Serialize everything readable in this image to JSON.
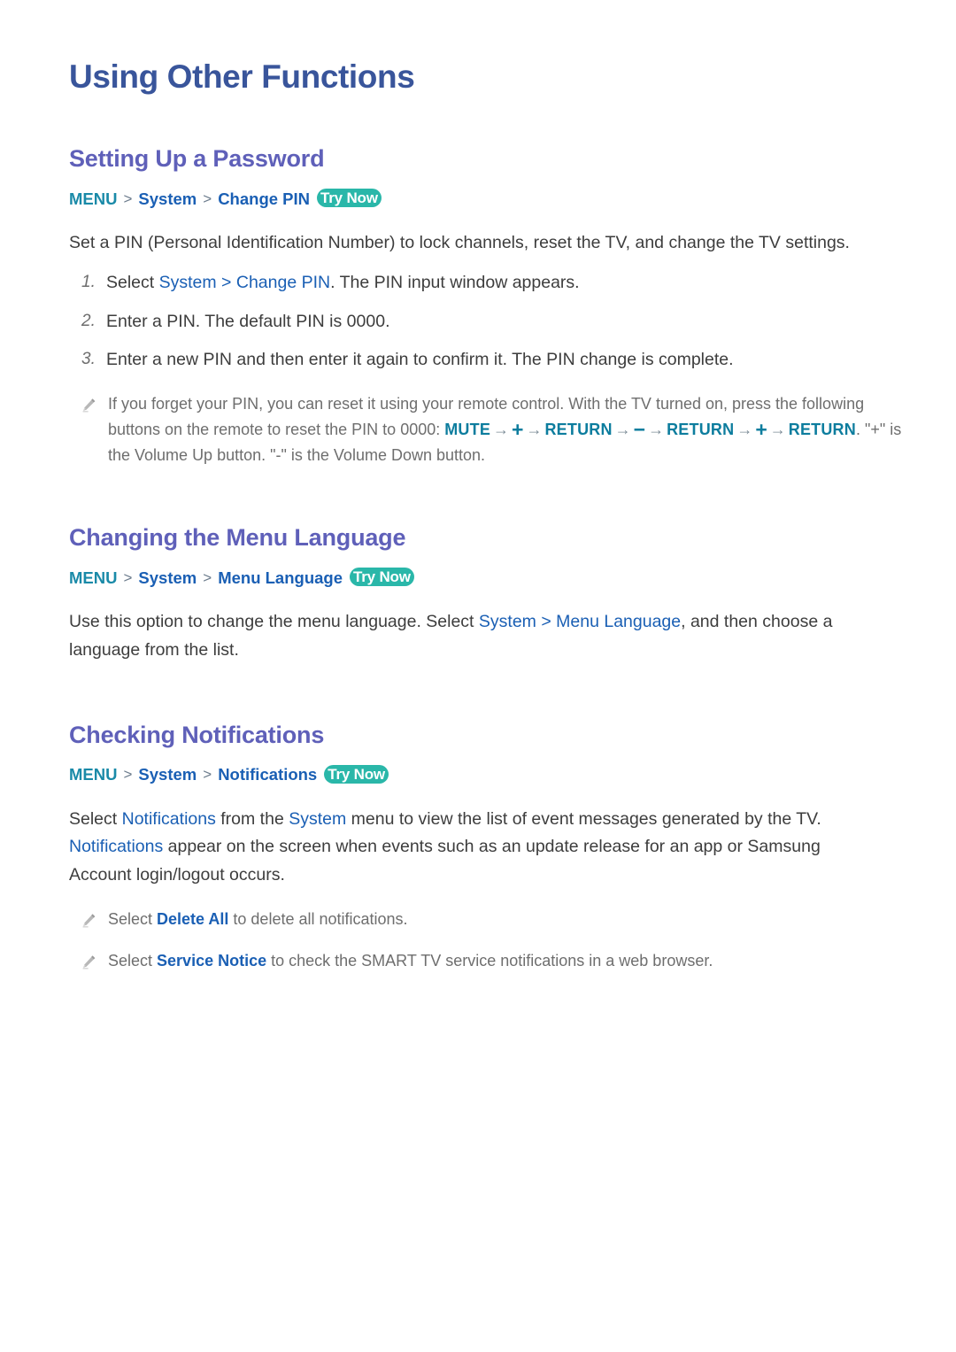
{
  "document": {
    "title": "Using Other Functions"
  },
  "sections": [
    {
      "heading": "Setting Up a Password",
      "path": {
        "menu": "MENU",
        "sep": ">",
        "item1": "System",
        "item2": "Change PIN",
        "try_now": "Try Now"
      },
      "intro": {
        "before": "Set a PIN (Personal Identification Number) to lock channels, reset the TV, and change the TV settings."
      },
      "steps": [
        {
          "num": "1.",
          "pre": "Select ",
          "kw1": "System",
          "sep": " > ",
          "kw2": "Change PIN",
          "post": ". The PIN input window appears."
        },
        {
          "num": "2.",
          "pre": "Enter a PIN. The default PIN is 0000.",
          "kw1": "",
          "sep": "",
          "kw2": "",
          "post": ""
        },
        {
          "num": "3.",
          "pre": "Enter a new PIN and then enter it again to confirm it. The PIN change is complete.",
          "kw1": "",
          "sep": "",
          "kw2": "",
          "post": ""
        }
      ],
      "note": {
        "icon": "pencil-icon",
        "part1": "If you forget your PIN, you can reset it using your remote control. With the TV turned on, press the following buttons on the remote to reset the PIN to 0000: ",
        "btn_mute": "MUTE",
        "arrow": "→",
        "sym_plus": "+",
        "btn_return_1": "RETURN",
        "sym_minus": "−",
        "btn_return_2": "RETURN",
        "sym_plus_2": "+",
        "btn_return_3": "RETURN",
        "part2": ". \"+\" is the Volume Up button. \"-\" is the Volume Down button."
      }
    },
    {
      "heading": "Changing the Menu Language",
      "path": {
        "menu": "MENU",
        "sep": ">",
        "item1": "System",
        "item2": "Menu Language",
        "try_now": "Try Now"
      },
      "body": {
        "pre": "Use this option to change the menu language. Select ",
        "kw1": "System",
        "sep": " > ",
        "kw2": "Menu Language",
        "post": ", and then choose a language from the list."
      }
    },
    {
      "heading": "Checking Notifications",
      "path": {
        "menu": "MENU",
        "sep": ">",
        "item1": "System",
        "item2": "Notifications",
        "try_now": "Try Now"
      },
      "body": {
        "pre": "Select ",
        "kw1": "Notifications",
        "mid": " from the ",
        "kw2": "System",
        "mid2": " menu to view the list of event messages generated by the TV. ",
        "kw3": "Notifications",
        "post": " appear on the screen when events such as an update release for an app or Samsung Account login/logout occurs."
      },
      "notes": [
        {
          "icon": "pencil-icon",
          "pre": "Select ",
          "kw": "Delete All",
          "post": " to delete all notifications."
        },
        {
          "icon": "pencil-icon",
          "pre": "Select ",
          "kw": "Service Notice",
          "post": " to check the SMART TV service notifications in a web browser."
        }
      ]
    }
  ],
  "colors": {
    "title": "#39559b",
    "heading": "#5f60b9",
    "menu_token": "#1a8aa8",
    "link": "#1a5fb4",
    "try_now_bg": "#2ab7a9",
    "button_token": "#0d7d9e",
    "body": "#3d3d3d",
    "note": "#6e6e6e"
  }
}
